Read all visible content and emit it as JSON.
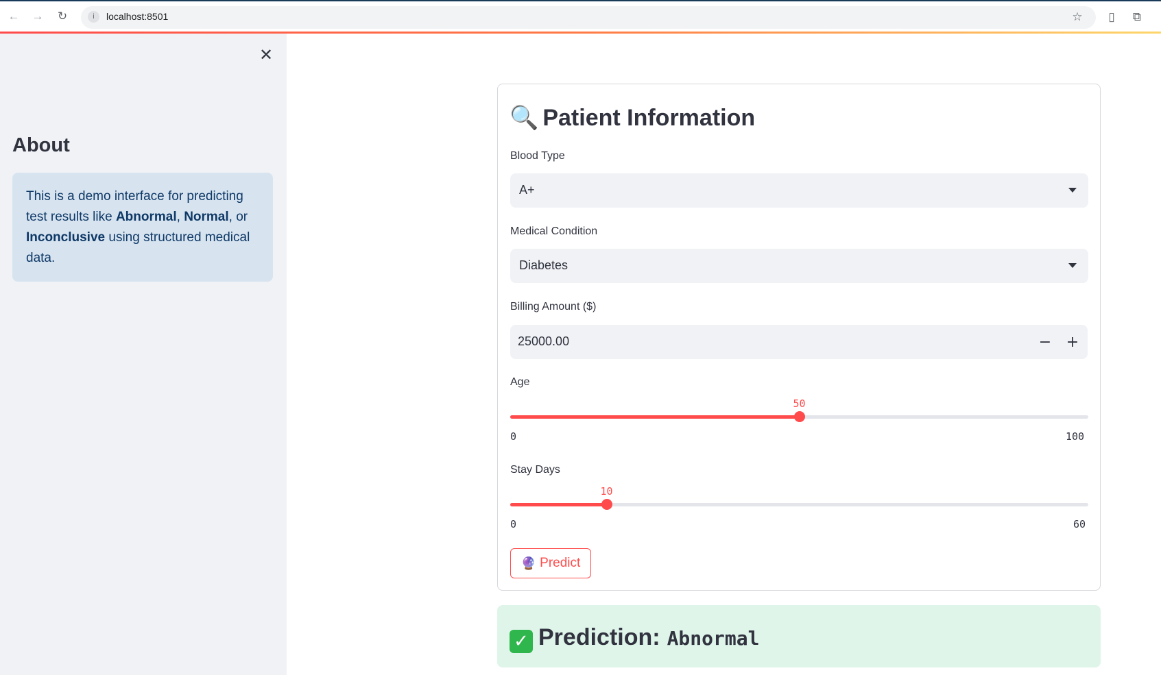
{
  "browser": {
    "url": "localhost:8501",
    "back_icon": "arrow-left-icon",
    "forward_icon": "arrow-right-icon",
    "reload_icon": "reload-icon"
  },
  "sidebar": {
    "heading": "About",
    "info_parts": {
      "p1": "This is a demo interface for predicting test results like ",
      "b1": "Abnormal",
      "p2": ", ",
      "b2": "Normal",
      "p3": ", or ",
      "b3": "Inconclusive",
      "p4": " using structured medical data."
    }
  },
  "form": {
    "title_emoji": "🔍",
    "title": "Patient Information",
    "blood_type": {
      "label": "Blood Type",
      "value": "A+"
    },
    "medical_condition": {
      "label": "Medical Condition",
      "value": "Diabetes"
    },
    "billing": {
      "label": "Billing Amount ($)",
      "value": "25000.00",
      "minus": "−",
      "plus": "+"
    },
    "age": {
      "label": "Age",
      "value": 50,
      "value_text": "50",
      "min": "0",
      "max": "100",
      "fraction": 0.5
    },
    "stay_days": {
      "label": "Stay Days",
      "value": 10,
      "value_text": "10",
      "min": "0",
      "max": "60",
      "fraction": 0.1667
    },
    "predict_emoji": "🔮",
    "predict_label": "Predict"
  },
  "result": {
    "icon": "✓",
    "label": "Prediction:",
    "value": "Abnormal"
  },
  "colors": {
    "accent": "#ff4b4b",
    "sidebar_bg": "#f0f2f6",
    "info_bg": "#d7e4f0",
    "success_bg": "#dff5ea"
  }
}
